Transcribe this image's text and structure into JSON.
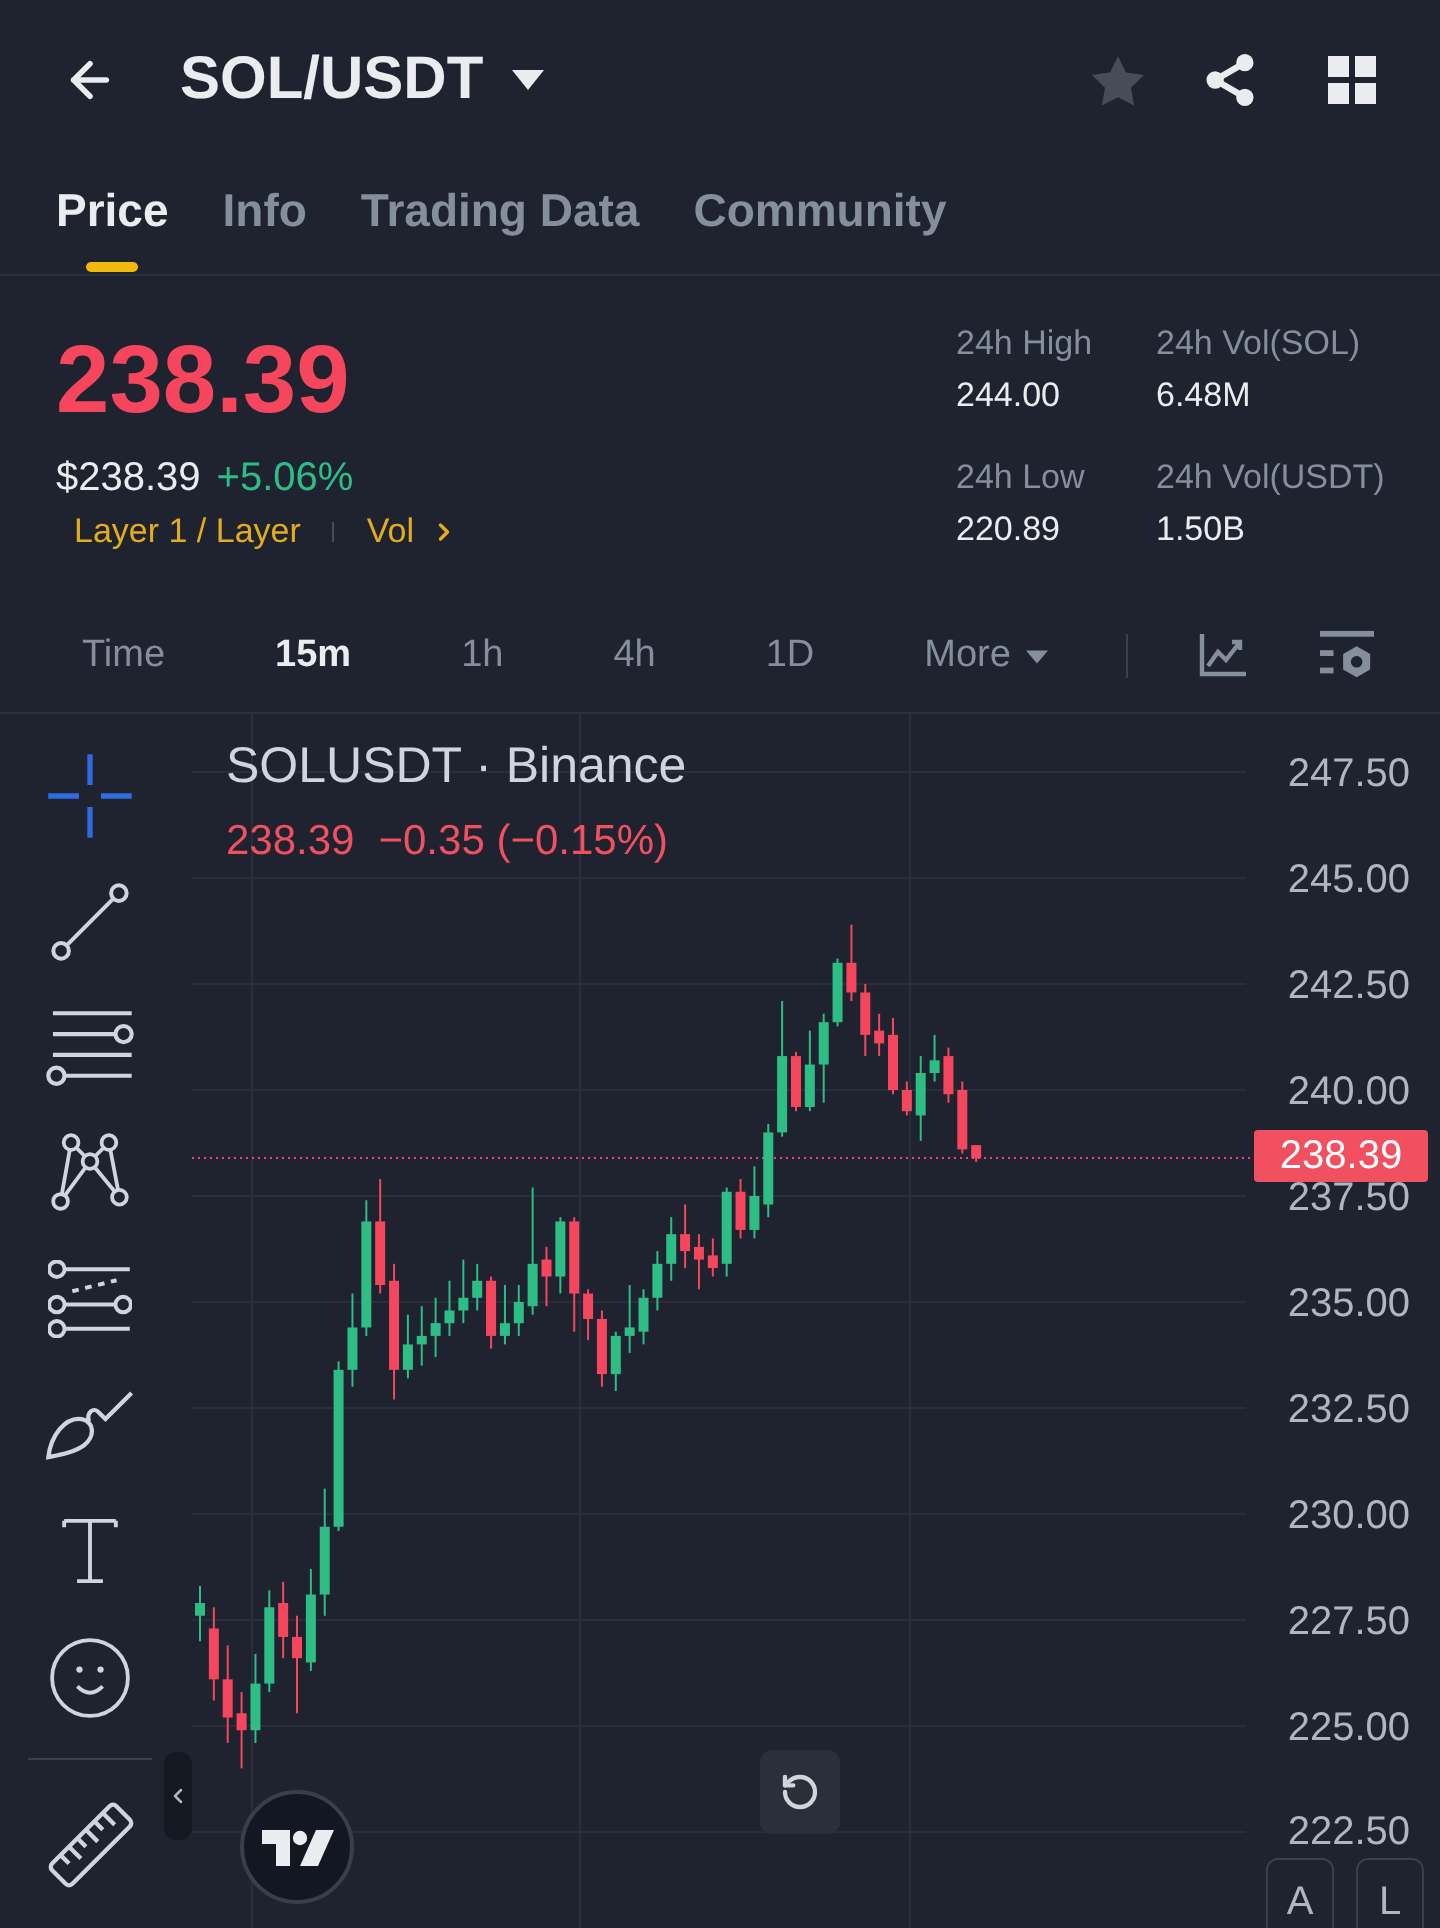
{
  "header": {
    "title": "SOL/USDT"
  },
  "tabs": [
    {
      "label": "Price",
      "selected": true
    },
    {
      "label": "Info",
      "selected": false
    },
    {
      "label": "Trading Data",
      "selected": false
    },
    {
      "label": "Community",
      "selected": false
    }
  ],
  "ticker": {
    "price": "238.39",
    "fiat_price": "$238.39",
    "change": "+5.06%",
    "category": "Layer 1 / Layer",
    "vol_link": "Vol"
  },
  "stats": [
    {
      "label": "24h High",
      "value": "244.00"
    },
    {
      "label": "24h Vol(SOL)",
      "value": "6.48M"
    },
    {
      "label": "24h Low",
      "value": "220.89"
    },
    {
      "label": "24h Vol(USDT)",
      "value": "1.50B"
    }
  ],
  "intervals": [
    {
      "kind": "interval",
      "label": "Time",
      "selected": false
    },
    {
      "kind": "interval",
      "label": "15m",
      "selected": true
    },
    {
      "kind": "interval",
      "label": "1h",
      "selected": false
    },
    {
      "kind": "interval",
      "label": "4h",
      "selected": false
    },
    {
      "kind": "interval",
      "label": "1D",
      "selected": false
    },
    {
      "kind": "dropdown",
      "label": "More",
      "selected": false
    }
  ],
  "drawing_tools": [
    {
      "kind": "crosshair",
      "selected": true
    },
    {
      "kind": "trend_line",
      "selected": false
    },
    {
      "kind": "horizontal_lines",
      "selected": false
    },
    {
      "kind": "pattern",
      "selected": false
    },
    {
      "kind": "fib",
      "selected": false
    },
    {
      "kind": "brush",
      "selected": false
    },
    {
      "kind": "text",
      "selected": false
    },
    {
      "kind": "emoji",
      "selected": false
    },
    {
      "kind": "ruler",
      "selected": false
    }
  ],
  "chart": {
    "symbol": "SOLUSDT · Binance",
    "price": "238.39",
    "change": "−0.35 (−0.15%)",
    "price_axis": [
      "247.50",
      "245.00",
      "242.50",
      "240.00",
      "237.50",
      "235.00",
      "232.50",
      "230.00",
      "227.50",
      "225.00",
      "222.50"
    ],
    "last_price_tag": "238.39"
  },
  "scale_buttons": [
    "A",
    "L"
  ]
}
